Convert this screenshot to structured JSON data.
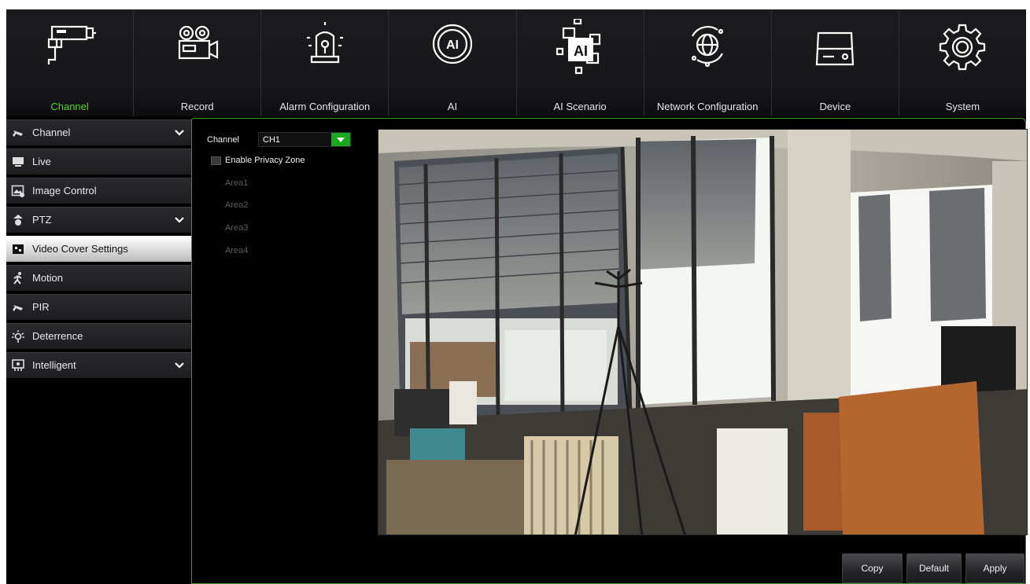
{
  "nav": {
    "tabs": [
      {
        "label": "Channel",
        "icon": "camera-icon",
        "active": true
      },
      {
        "label": "Record",
        "icon": "record-icon",
        "active": false
      },
      {
        "label": "Alarm Configuration",
        "icon": "alarm-icon",
        "active": false
      },
      {
        "label": "AI",
        "icon": "ai-icon",
        "active": false
      },
      {
        "label": "AI Scenario",
        "icon": "ai-scenario-icon",
        "active": false
      },
      {
        "label": "Network Configuration",
        "icon": "network-icon",
        "active": false
      },
      {
        "label": "Device",
        "icon": "device-icon",
        "active": false
      },
      {
        "label": "System",
        "icon": "system-gear-icon",
        "active": false
      }
    ],
    "active_color": "#4dd81f"
  },
  "sidebar": {
    "items": [
      {
        "label": "Channel",
        "icon": "camera-icon",
        "expandable": true
      },
      {
        "label": "Live",
        "icon": "monitor-icon",
        "expandable": false
      },
      {
        "label": "Image Control",
        "icon": "image-icon",
        "expandable": false
      },
      {
        "label": "PTZ",
        "icon": "ptz-icon",
        "expandable": true
      },
      {
        "label": "Video Cover Settings",
        "icon": "video-cover-icon",
        "expandable": false,
        "active": true
      },
      {
        "label": "Motion",
        "icon": "motion-icon",
        "expandable": false
      },
      {
        "label": "PIR",
        "icon": "pir-icon",
        "expandable": false
      },
      {
        "label": "Deterrence",
        "icon": "light-icon",
        "expandable": false
      },
      {
        "label": "Intelligent",
        "icon": "intelligent-icon",
        "expandable": true
      }
    ]
  },
  "form": {
    "channel_label": "Channel",
    "channel_value": "CH1",
    "privacy_zone_label": "Enable Privacy Zone",
    "privacy_zone_enabled": false,
    "areas": [
      "Area1",
      "Area2",
      "Area3",
      "Area4"
    ]
  },
  "buttons": {
    "copy": "Copy",
    "default": "Default",
    "apply": "Apply"
  },
  "colors": {
    "accent_green": "#4dd81f",
    "dropdown_green": "#17a81f",
    "content_border": "#3b9b27"
  }
}
